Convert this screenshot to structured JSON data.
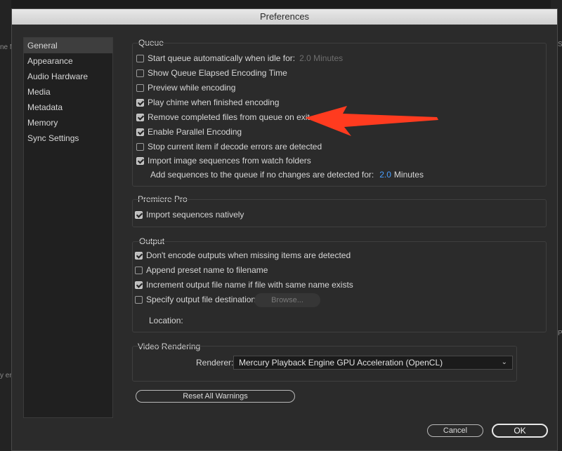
{
  "background": {
    "left_fragments": [
      "ne M",
      "y en"
    ],
    "right_fragments": [
      "S",
      "P"
    ]
  },
  "dialog": {
    "title": "Preferences"
  },
  "sidebar": {
    "items": [
      {
        "label": "General",
        "active": true
      },
      {
        "label": "Appearance"
      },
      {
        "label": "Audio Hardware"
      },
      {
        "label": "Media"
      },
      {
        "label": "Metadata"
      },
      {
        "label": "Memory"
      },
      {
        "label": "Sync Settings"
      }
    ]
  },
  "queue": {
    "title": "Queue",
    "start_queue": {
      "label": "Start queue automatically when idle for:",
      "checked": false,
      "value": "2.0 Minutes"
    },
    "show_elapsed": {
      "label": "Show Queue Elapsed Encoding Time",
      "checked": false
    },
    "preview": {
      "label": "Preview while encoding",
      "checked": false
    },
    "chime": {
      "label": "Play chime when finished encoding",
      "checked": true
    },
    "remove_completed": {
      "label": "Remove completed files from queue on exit",
      "checked": true
    },
    "parallel": {
      "label": "Enable Parallel Encoding",
      "checked": true
    },
    "stop_current": {
      "label": "Stop current item if decode errors are detected",
      "checked": false
    },
    "import_sequences": {
      "label": "Import image sequences from watch folders",
      "checked": true
    },
    "add_sequences": {
      "label": "Add sequences to the queue if no changes are detected for:",
      "value": "2.0",
      "unit": "Minutes"
    }
  },
  "premiere": {
    "title": "Premiere Pro",
    "import_natively": {
      "label": "Import sequences natively",
      "checked": true
    }
  },
  "output": {
    "title": "Output",
    "dont_encode": {
      "label": "Don't encode outputs when missing items are detected",
      "checked": true
    },
    "append_preset": {
      "label": "Append preset name to filename",
      "checked": false
    },
    "increment": {
      "label": "Increment output file name if file with same name exists",
      "checked": true
    },
    "specify_dest": {
      "label": "Specify output file destination:",
      "checked": false
    },
    "browse_label": "Browse...",
    "location_label": "Location:"
  },
  "video_rendering": {
    "title": "Video Rendering",
    "renderer_label": "Renderer:",
    "renderer_value": "Mercury Playback Engine GPU Acceleration (OpenCL)"
  },
  "buttons": {
    "reset_warnings": "Reset All Warnings",
    "cancel": "Cancel",
    "ok": "OK"
  },
  "colors": {
    "annotation_arrow": "#ff3b1f",
    "accent_value": "#4aa0ff"
  }
}
